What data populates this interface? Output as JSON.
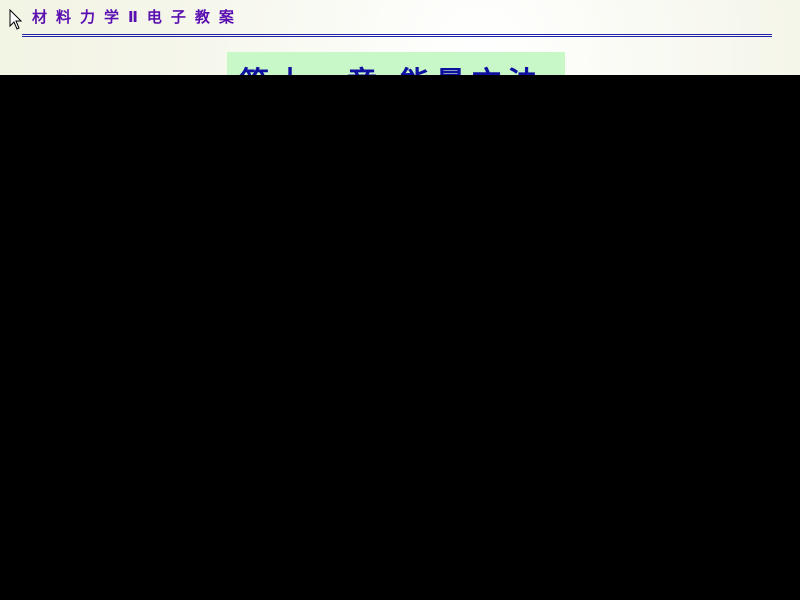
{
  "header": {
    "course_title": "材料力学Ⅱ电子教案"
  },
  "slide": {
    "chapter_title": "第十一章 能量方法"
  }
}
